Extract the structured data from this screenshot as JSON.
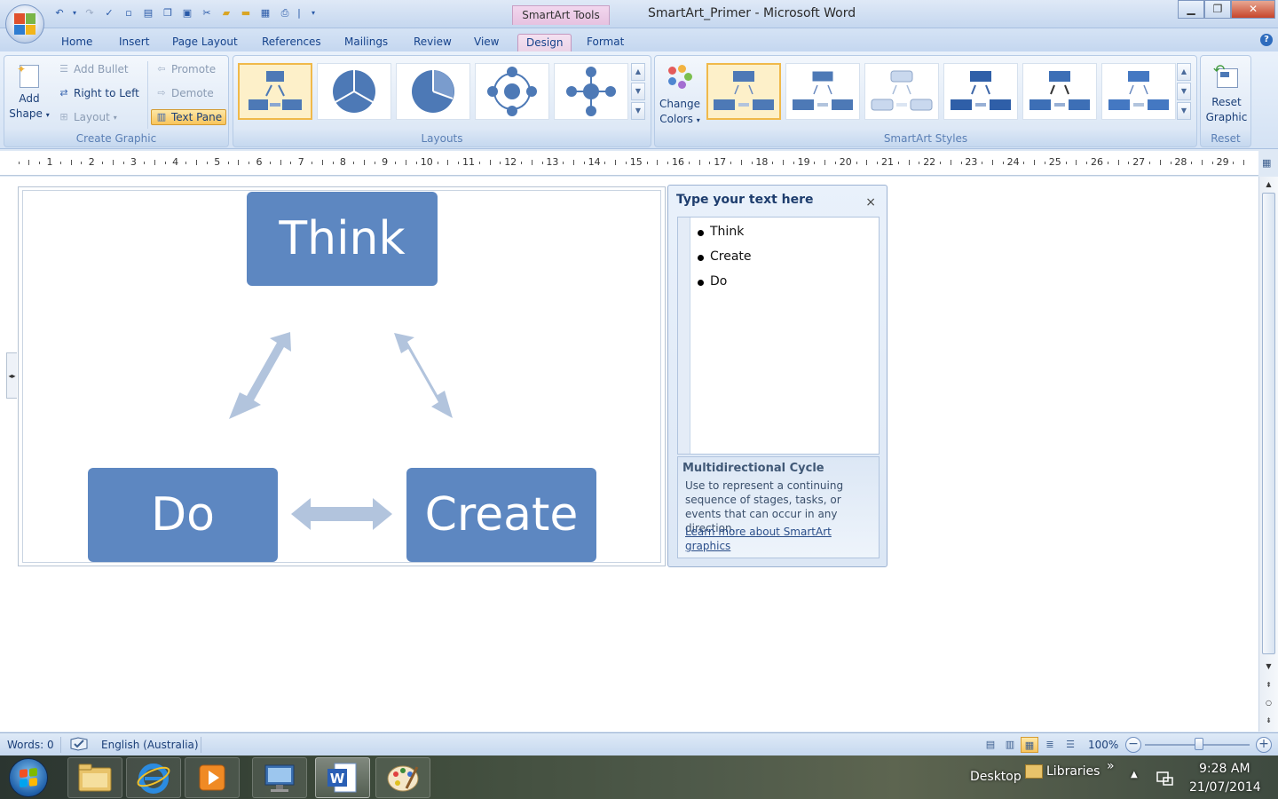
{
  "window": {
    "context_tab": "SmartArt Tools",
    "title": "SmartArt_Primer - Microsoft Word",
    "minimize_icon": "minimize-icon",
    "maximize_icon": "restore-icon",
    "close_icon": "close-icon"
  },
  "tabs": [
    {
      "label": "Home"
    },
    {
      "label": "Insert"
    },
    {
      "label": "Page Layout"
    },
    {
      "label": "References"
    },
    {
      "label": "Mailings"
    },
    {
      "label": "Review"
    },
    {
      "label": "View"
    },
    {
      "label": "Design",
      "active": true
    },
    {
      "label": "Format"
    }
  ],
  "ribbon": {
    "create_graphic": {
      "label": "Create Graphic",
      "add_shape": "Add\nShape",
      "add_shape_line1": "Add",
      "add_shape_line2": "Shape",
      "add_bullet": "Add Bullet",
      "right_to_left": "Right to Left",
      "layout": "Layout",
      "promote": "Promote",
      "demote": "Demote",
      "text_pane": "Text Pane"
    },
    "layouts": {
      "label": "Layouts"
    },
    "smartart_styles": {
      "label": "SmartArt Styles",
      "change_colors_line1": "Change",
      "change_colors_line2": "Colors"
    },
    "reset": {
      "label": "Reset",
      "reset_graphic_line1": "Reset",
      "reset_graphic_line2": "Graphic"
    }
  },
  "ruler": {
    "numbers": [
      "1",
      "2",
      "3",
      "4",
      "5",
      "6",
      "7",
      "8",
      "9",
      "10",
      "11",
      "12",
      "13",
      "14",
      "15",
      "16",
      "17",
      "18",
      "19",
      "20",
      "21",
      "22",
      "23",
      "24",
      "25",
      "26",
      "27",
      "28",
      "29"
    ]
  },
  "smartart": {
    "nodes": {
      "think": "Think",
      "create": "Create",
      "do": "Do"
    },
    "colors": {
      "node_fill": "#5d87c1",
      "arrow_fill": "#b2c4dd"
    }
  },
  "text_pane": {
    "title": "Type your text here",
    "close": "×",
    "items": [
      "Think",
      "Create",
      "Do"
    ],
    "desc_title": "Multidirectional Cycle",
    "desc_body": "Use to represent a continuing sequence of stages, tasks, or events that can occur in any direction.",
    "desc_link": "Learn more about SmartArt graphics"
  },
  "status": {
    "words": "Words: 0",
    "language": "English (Australia)",
    "zoom": "100%"
  },
  "taskbar": {
    "desktop": "Desktop",
    "libraries": "Libraries",
    "chevron": "»",
    "time": "9:28 AM",
    "date": "21/07/2014"
  }
}
